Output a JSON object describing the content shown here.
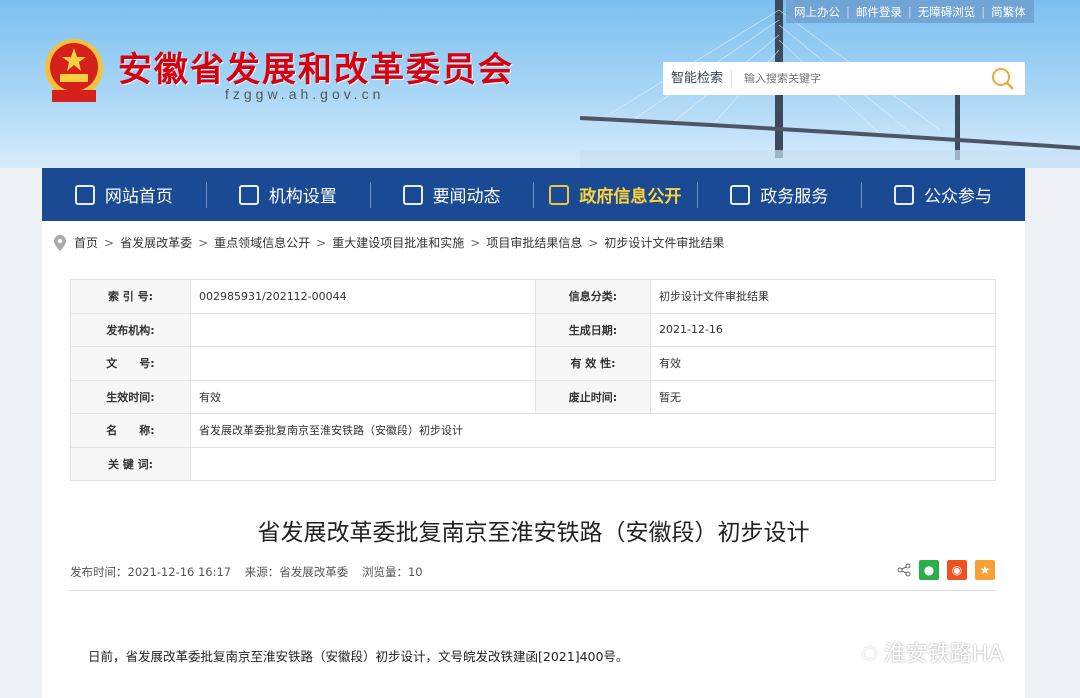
{
  "header": {
    "title": "安徽省发展和改革委员会",
    "url": "fzggw.ah.gov.cn",
    "top_links": [
      "网上办公",
      "邮件登录",
      "无障碍浏览",
      "简繁体"
    ],
    "search_label": "智能检索",
    "search_placeholder": "输入搜索关键字"
  },
  "nav": [
    "网站首页",
    "机构设置",
    "要闻动态",
    "政府信息公开",
    "政务服务",
    "公众参与"
  ],
  "breadcrumb": [
    "首页",
    "省发展改革委",
    "重点领域信息公开",
    "重大建设项目批准和实施",
    "项目审批结果信息",
    "初步设计文件审批结果"
  ],
  "info": {
    "rows": [
      [
        "索 引 号:",
        "002985931/202112-00044",
        "信息分类:",
        "初步设计文件审批结果"
      ],
      [
        "发布机构:",
        "",
        "生成日期:",
        "2021-12-16"
      ],
      [
        "文　　号:",
        "",
        "有 效 性:",
        "有效"
      ],
      [
        "生效时间:",
        "有效",
        "废止时间:",
        "暂无"
      ]
    ],
    "name_label": "名　　称:",
    "name_value": "省发展改革委批复南京至淮安铁路（安徽段）初步设计",
    "keyword_label": "关 键 词:",
    "keyword_value": ""
  },
  "article": {
    "title": "省发展改革委批复南京至淮安铁路（安徽段）初步设计",
    "published": "发布时间：2021-12-16 16:17",
    "source": "来源：省发展改革委",
    "views": "浏览量：10",
    "body": "日前，省发展改革委批复南京至淮安铁路（安徽段）初步设计，文号皖发改铁建函[2021]400号。"
  },
  "watermark": "淮安铁路HA",
  "colors": {
    "nav": "#1b4a95",
    "title_red": "#d7000f",
    "active": "#ffd338"
  }
}
